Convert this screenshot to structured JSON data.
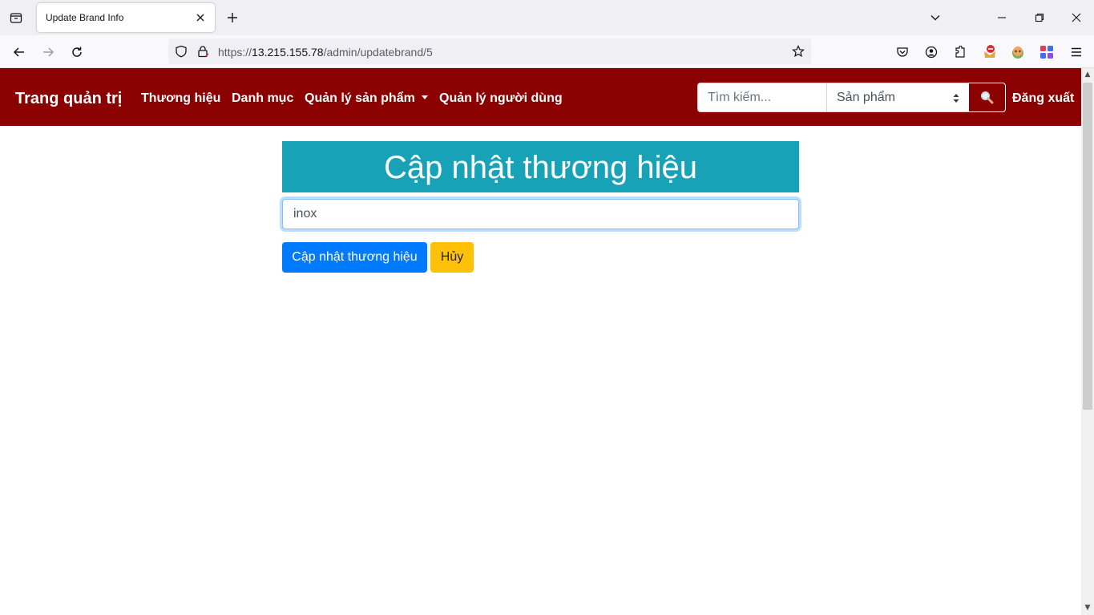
{
  "browser": {
    "tab_title": "Update Brand Info",
    "url_prefix": "https://",
    "url_host": "13.215.155.78",
    "url_path": "/admin/updatebrand/5"
  },
  "site_nav": {
    "brand": "Trang quản trị",
    "links": [
      "Thương hiệu",
      "Danh mục",
      "Quản lý sản phẩm",
      "Quản lý người dùng"
    ],
    "search_placeholder": "Tìm kiếm...",
    "search_category": "Sản phẩm",
    "logout": "Đăng xuất",
    "nav_color": "#8b0000"
  },
  "form": {
    "heading": "Cập nhật thương hiệu",
    "brand_name_value": "inox",
    "update_button": "Cập nhật thương hiệu",
    "cancel_button": "Hủy",
    "heading_color": "#17a2b8",
    "primary_color": "#007bff",
    "warning_color": "#ffc107"
  }
}
